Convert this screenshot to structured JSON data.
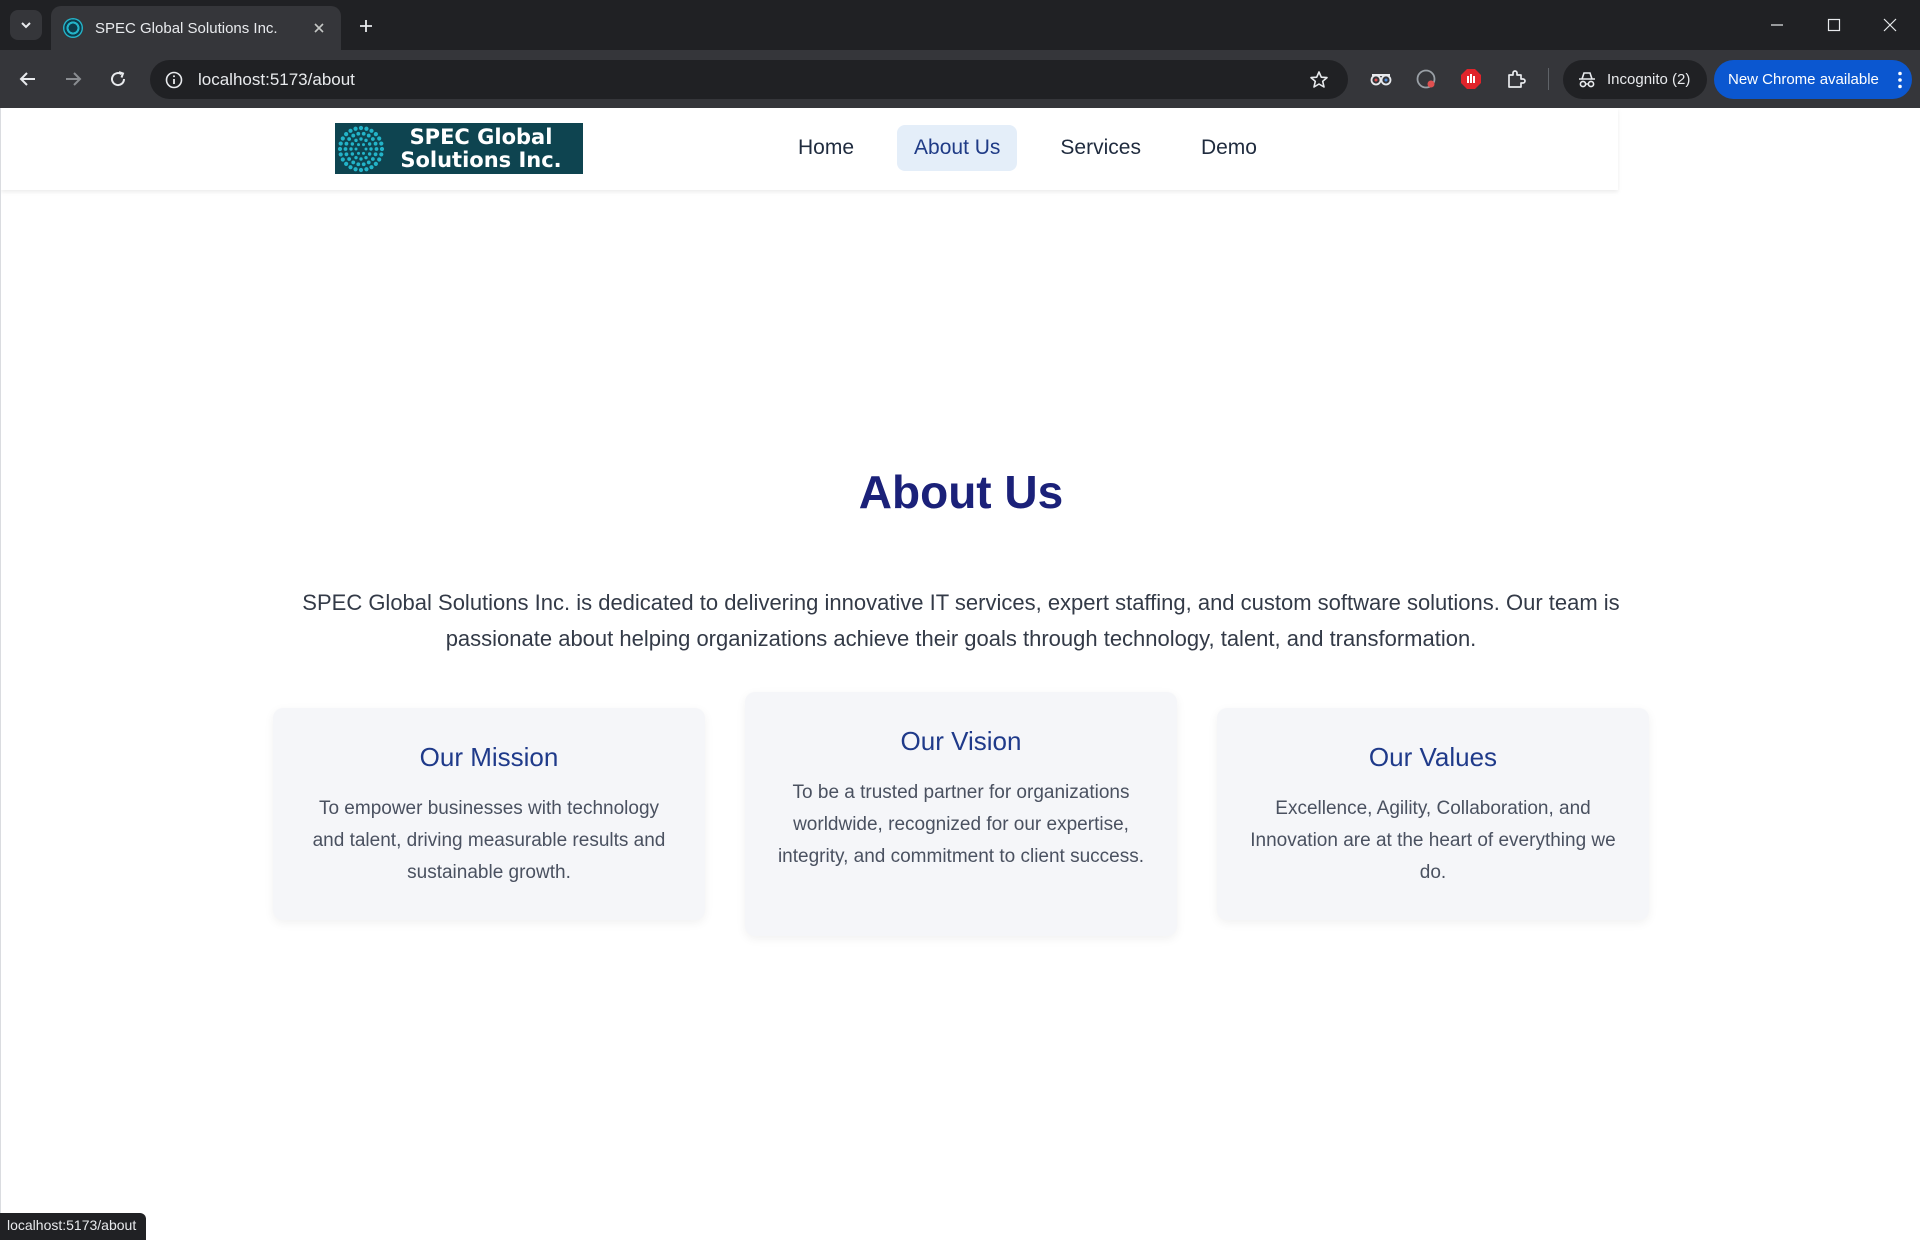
{
  "browser": {
    "tab_title": "SPEC Global Solutions Inc.",
    "url": "localhost:5173/about",
    "incognito_label": "Incognito (2)",
    "update_label": "New Chrome available",
    "status_url": "localhost:5173/about"
  },
  "site": {
    "logo_line1": "SPEC Global",
    "logo_line2": "Solutions Inc.",
    "nav": [
      {
        "label": "Home",
        "active": false
      },
      {
        "label": "About Us",
        "active": true
      },
      {
        "label": "Services",
        "active": false
      },
      {
        "label": "Demo",
        "active": false
      }
    ]
  },
  "page": {
    "title": "About Us",
    "intro": "SPEC Global Solutions Inc. is dedicated to delivering innovative IT services, expert staffing, and custom software solutions. Our team is passionate about helping organizations achieve their goals through technology, talent, and transformation.",
    "cards": [
      {
        "title": "Our Mission",
        "text": "To empower businesses with technology and talent, driving measurable results and sustainable growth."
      },
      {
        "title": "Our Vision",
        "text": "To be a trusted partner for organizations worldwide, recognized for our expertise, integrity, and commitment to client success."
      },
      {
        "title": "Our Values",
        "text": "Excellence, Agility, Collaboration, and Innovation are at the heart of everything we do."
      }
    ]
  },
  "colors": {
    "heading": "#1b2179",
    "card_title": "#1f3a8a",
    "active_nav_bg": "#e4eef9",
    "logo_bg": "#0e4450",
    "logo_dots": "#23b4c9"
  }
}
